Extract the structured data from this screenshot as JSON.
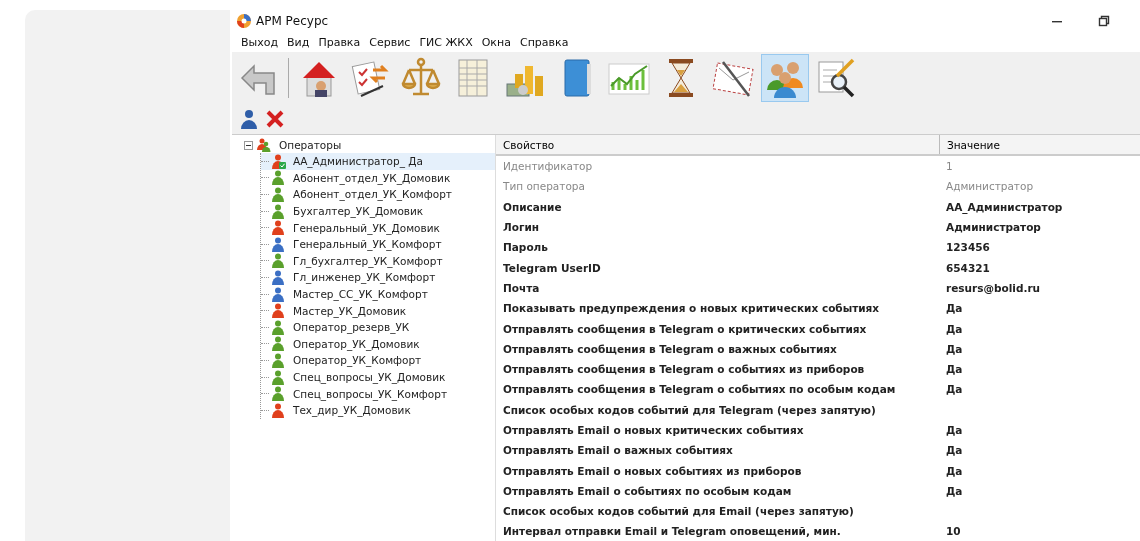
{
  "window": {
    "title": "АРМ Ресурс"
  },
  "menu": [
    "Выход",
    "Вид",
    "Правка",
    "Сервис",
    "ГИС ЖКХ",
    "Окна",
    "Справка"
  ],
  "toolbar": [
    {
      "kind": "back",
      "selected": false
    },
    {
      "kind": "house",
      "selected": false
    },
    {
      "kind": "document",
      "selected": false
    },
    {
      "kind": "scales",
      "selected": false
    },
    {
      "kind": "sheet",
      "selected": false
    },
    {
      "kind": "coins",
      "selected": false
    },
    {
      "kind": "book",
      "selected": false
    },
    {
      "kind": "chart",
      "selected": false
    },
    {
      "kind": "hourglass",
      "selected": false
    },
    {
      "kind": "envelope",
      "selected": false
    },
    {
      "kind": "people",
      "selected": true
    },
    {
      "kind": "inspect",
      "selected": false
    }
  ],
  "actions": [
    {
      "kind": "person"
    },
    {
      "kind": "delete"
    }
  ],
  "tree": {
    "label": "Операторы",
    "expanded": true,
    "children": [
      {
        "label": "АА_Администратор_ Да",
        "color": "#e0401c",
        "selected": true,
        "current": true
      },
      {
        "label": "Абонент_отдел_УК_Домовик",
        "color": "#5aa02c",
        "selected": false,
        "current": false
      },
      {
        "label": "Абонент_отдел_УК_Комфорт",
        "color": "#5aa02c",
        "selected": false,
        "current": false
      },
      {
        "label": "Бухгалтер_УК_Домовик",
        "color": "#5aa02c",
        "selected": false,
        "current": false
      },
      {
        "label": "Генеральный_УК_Домовик",
        "color": "#e0401c",
        "selected": false,
        "current": false
      },
      {
        "label": "Генеральный_УК_Комфорт",
        "color": "#3b6fc4",
        "selected": false,
        "current": false
      },
      {
        "label": "Гл_бухгалтер_УК_Комфорт",
        "color": "#5aa02c",
        "selected": false,
        "current": false
      },
      {
        "label": "Гл_инженер_УК_Комфорт",
        "color": "#3b6fc4",
        "selected": false,
        "current": false
      },
      {
        "label": "Мастер_СС_УК_Комфорт",
        "color": "#3b6fc4",
        "selected": false,
        "current": false
      },
      {
        "label": "Мастер_УК_Домовик",
        "color": "#e0401c",
        "selected": false,
        "current": false
      },
      {
        "label": "Оператор_резерв_УК",
        "color": "#5aa02c",
        "selected": false,
        "current": false
      },
      {
        "label": "Оператор_УК_Домовик",
        "color": "#5aa02c",
        "selected": false,
        "current": false
      },
      {
        "label": "Оператор_УК_Комфорт",
        "color": "#5aa02c",
        "selected": false,
        "current": false
      },
      {
        "label": "Спец_вопросы_УК_Домовик",
        "color": "#5aa02c",
        "selected": false,
        "current": false
      },
      {
        "label": "Спец_вопросы_УК_Комфорт",
        "color": "#5aa02c",
        "selected": false,
        "current": false
      },
      {
        "label": "Тех_дир_УК_Домовик",
        "color": "#e0401c",
        "selected": false,
        "current": false
      }
    ]
  },
  "grid": {
    "columns": [
      "Свойство",
      "Значение"
    ],
    "rows": [
      {
        "property": "Идентификатор",
        "value": "1",
        "readonly": true
      },
      {
        "property": "Тип оператора",
        "value": "Администратор",
        "readonly": true
      },
      {
        "property": "Описание",
        "value": "АА_Администратор",
        "readonly": false
      },
      {
        "property": "Логин",
        "value": "Администратор",
        "readonly": false
      },
      {
        "property": "Пароль",
        "value": "123456",
        "readonly": false
      },
      {
        "property": "Telegram UserID",
        "value": "654321",
        "readonly": false
      },
      {
        "property": "Почта",
        "value": "resurs@bolid.ru",
        "readonly": false
      },
      {
        "property": "Показывать предупреждения о новых критических событиях",
        "value": "Да",
        "readonly": false
      },
      {
        "property": "Отправлять сообщения в Telegram о критических событиях",
        "value": "Да",
        "readonly": false
      },
      {
        "property": "Отправлять сообщения в Telegram о важных событиях",
        "value": "Да",
        "readonly": false
      },
      {
        "property": "Отправлять сообщения в Telegram о событиях из приборов",
        "value": "Да",
        "readonly": false
      },
      {
        "property": "Отправлять сообщения в Telegram о событиях по особым кодам",
        "value": "Да",
        "readonly": false
      },
      {
        "property": "Список особых кодов событий для Telegram (через запятую)",
        "readonly": false
      },
      {
        "property": "Отправлять Email о новых критических событиях",
        "value": "Да",
        "readonly": false
      },
      {
        "property": "Отправлять Email о важных событиях",
        "value": "Да",
        "readonly": false
      },
      {
        "property": "Отправлять Email о новых событиях из приборов",
        "value": "Да",
        "readonly": false
      },
      {
        "property": "Отправлять Email о событиях по особым кодам",
        "value": "Да",
        "readonly": false
      },
      {
        "property": "Список особых кодов событий для Email (через запятую)",
        "readonly": false
      },
      {
        "property": "Интервал отправки Email и Telegram оповещений, мин.",
        "value": "10",
        "readonly": false
      }
    ]
  }
}
